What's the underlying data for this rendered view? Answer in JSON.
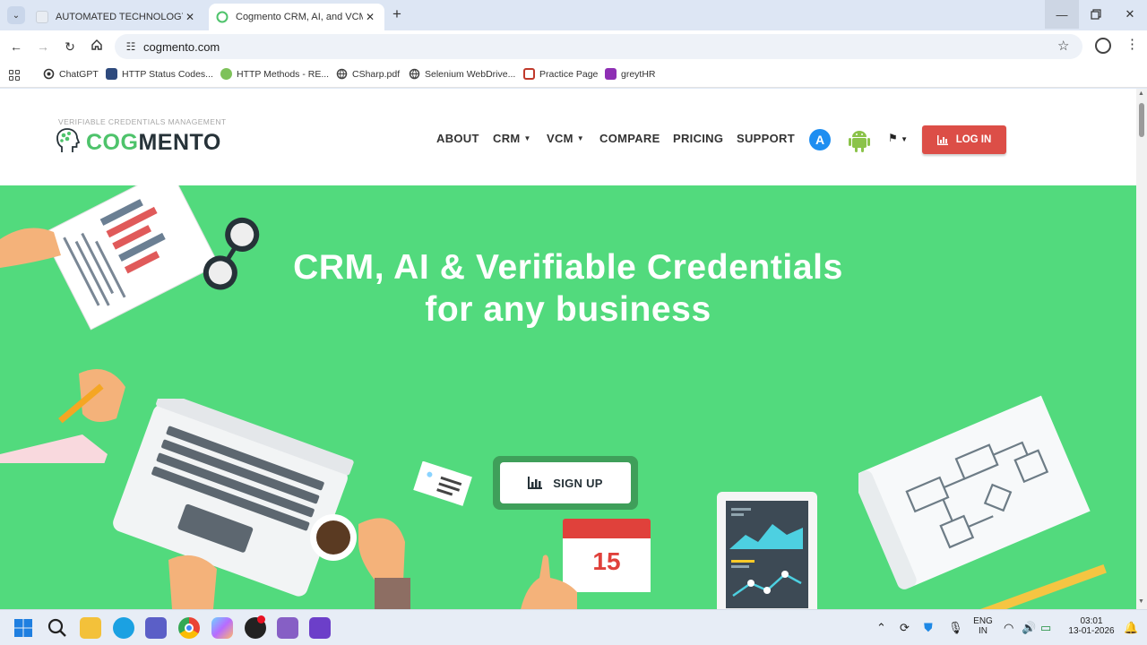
{
  "browser": {
    "tabs": [
      {
        "title": "AUTOMATED TECHNOLOGY SOLU",
        "active": false
      },
      {
        "title": "Cogmento CRM, AI, and VCM: C",
        "active": true
      }
    ],
    "url": "cogmento.com",
    "bookmarks": [
      {
        "label": "ChatGPT",
        "icon": "chatgpt-icon"
      },
      {
        "label": "HTTP Status Codes...",
        "icon": "http-status-icon"
      },
      {
        "label": "HTTP Methods - RE...",
        "icon": "http-methods-icon"
      },
      {
        "label": "CSharp.pdf",
        "icon": "globe-icon"
      },
      {
        "label": "Selenium WebDrive...",
        "icon": "globe-icon"
      },
      {
        "label": "Practice Page",
        "icon": "practice-icon"
      },
      {
        "label": "greytHR",
        "icon": "greythr-icon"
      }
    ]
  },
  "site": {
    "tagline": "VERIFIABLE CREDENTIALS MANAGEMENT",
    "brand_part1": "COG",
    "brand_part2": "MENTO",
    "nav": {
      "about": "ABOUT",
      "crm": "CRM",
      "vcm": "VCM",
      "compare": "COMPARE",
      "pricing": "PRICING",
      "support": "SUPPORT"
    },
    "login": "LOG IN",
    "hero": {
      "line1": "CRM, AI & Verifiable Credentials",
      "line2": "for any business",
      "signup": "SIGN UP"
    },
    "calendar_day": "15",
    "colors": {
      "hero_bg": "#52da7d",
      "brand_green": "#4ec36b",
      "login_red": "#dc4e47"
    }
  },
  "taskbar": {
    "language": "ENG",
    "region": "IN",
    "time": "03:01",
    "date": "13-01-2026"
  }
}
